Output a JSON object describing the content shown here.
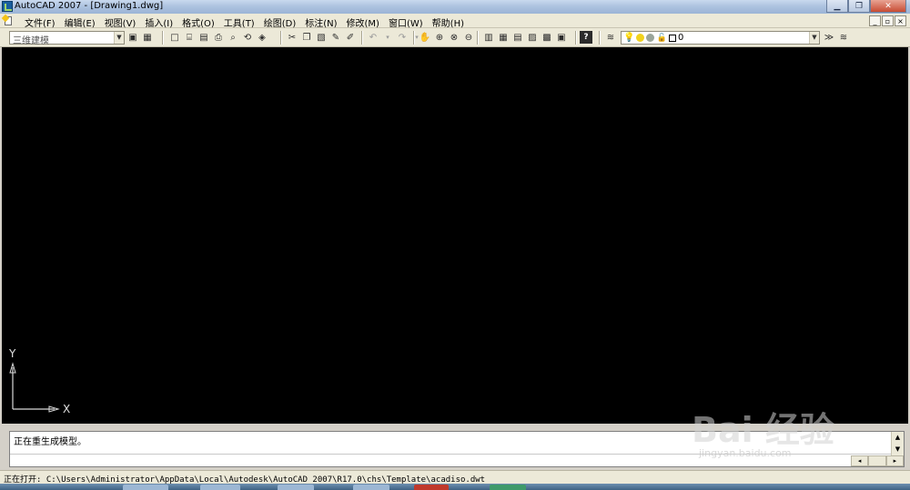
{
  "window": {
    "title": "AutoCAD 2007 - [Drawing1.dwg]",
    "controls": [
      "_",
      "□",
      "X"
    ]
  },
  "menu": {
    "items": [
      "文件(F)",
      "编辑(E)",
      "视图(V)",
      "插入(I)",
      "格式(O)",
      "工具(T)",
      "绘图(D)",
      "标注(N)",
      "修改(M)",
      "窗口(W)",
      "帮助(H)"
    ],
    "mdi_controls": [
      "_",
      "▫",
      "×"
    ]
  },
  "toolbar": {
    "workspace": "三维建模",
    "layer": "0",
    "icons": [
      "new-icon",
      "open-icon",
      "save-icon",
      "print-icon",
      "preview-icon",
      "publish-icon",
      "cut-icon",
      "copy-icon",
      "paste-icon",
      "match-icon",
      "undo-icon",
      "redo-icon",
      "pan-icon",
      "zoom-icon"
    ]
  },
  "canvas": {
    "ucs_y": "Y",
    "ucs_x": "X",
    "background": "#000000"
  },
  "command": {
    "line1": "正在重生成模型。"
  },
  "status": {
    "text": "正在打开: C:\\Users\\Administrator\\AppData\\Local\\Autodesk\\AutoCAD 2007\\R17.0\\chs\\Template\\acadiso.dwt"
  },
  "watermark": {
    "text": "Bai 经验",
    "url_text": "jingyan.baidu.com"
  }
}
